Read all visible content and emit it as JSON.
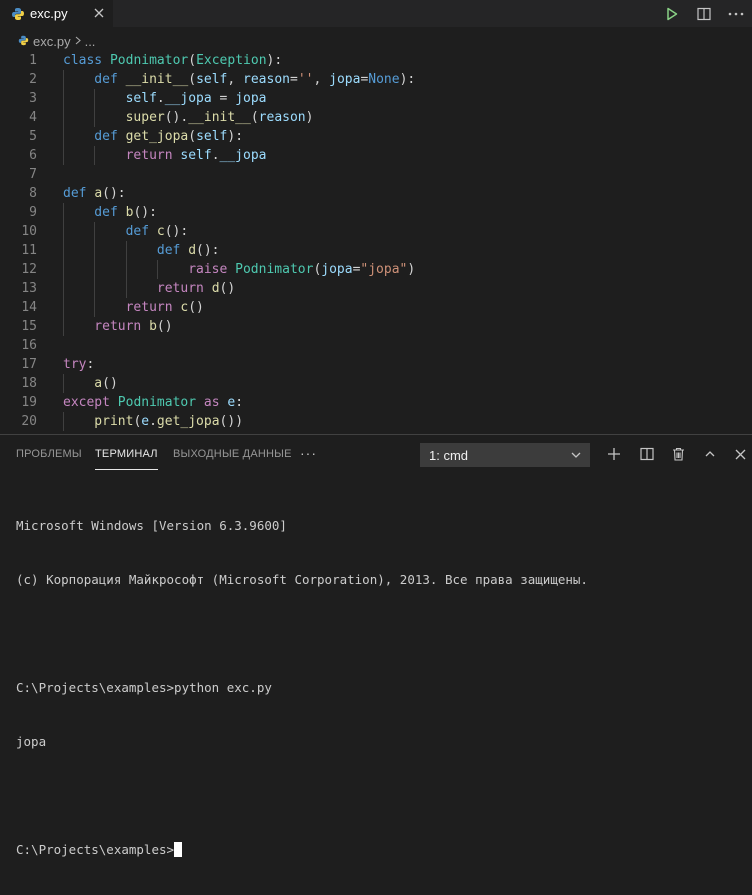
{
  "tab": {
    "filename": "exc.py"
  },
  "breadcrumb": {
    "file": "exc.py",
    "more": "..."
  },
  "editor": {
    "lines": [
      {
        "num": "1",
        "indent": 0,
        "tokens": [
          [
            "kw",
            "class "
          ],
          [
            "cls",
            "Podnimator"
          ],
          [
            "tx",
            "("
          ],
          [
            "cls",
            "Exception"
          ],
          [
            "tx",
            "):"
          ]
        ]
      },
      {
        "num": "2",
        "indent": 1,
        "tokens": [
          [
            "kw",
            "def "
          ],
          [
            "fn",
            "__init__"
          ],
          [
            "tx",
            "("
          ],
          [
            "prm",
            "self"
          ],
          [
            "tx",
            ", "
          ],
          [
            "prm",
            "reason"
          ],
          [
            "tx",
            "="
          ],
          [
            "str",
            "''"
          ],
          [
            "tx",
            ", "
          ],
          [
            "prm",
            "jopa"
          ],
          [
            "tx",
            "="
          ],
          [
            "kw",
            "None"
          ],
          [
            "tx",
            "):"
          ]
        ]
      },
      {
        "num": "3",
        "indent": 2,
        "tokens": [
          [
            "prm",
            "self"
          ],
          [
            "tx",
            "."
          ],
          [
            "prm",
            "__jopa"
          ],
          [
            "tx",
            " = "
          ],
          [
            "prm",
            "jopa"
          ]
        ]
      },
      {
        "num": "4",
        "indent": 2,
        "tokens": [
          [
            "fn",
            "super"
          ],
          [
            "tx",
            "()."
          ],
          [
            "fn",
            "__init__"
          ],
          [
            "tx",
            "("
          ],
          [
            "prm",
            "reason"
          ],
          [
            "tx",
            ")"
          ]
        ]
      },
      {
        "num": "5",
        "indent": 1,
        "tokens": [
          [
            "kw",
            "def "
          ],
          [
            "fn",
            "get_jopa"
          ],
          [
            "tx",
            "("
          ],
          [
            "prm",
            "self"
          ],
          [
            "tx",
            "):"
          ]
        ]
      },
      {
        "num": "6",
        "indent": 2,
        "tokens": [
          [
            "ctl",
            "return "
          ],
          [
            "prm",
            "self"
          ],
          [
            "tx",
            "."
          ],
          [
            "prm",
            "__jopa"
          ]
        ]
      },
      {
        "num": "7",
        "indent": 0,
        "tokens": []
      },
      {
        "num": "8",
        "indent": 0,
        "tokens": [
          [
            "kw",
            "def "
          ],
          [
            "fn",
            "a"
          ],
          [
            "tx",
            "():"
          ]
        ]
      },
      {
        "num": "9",
        "indent": 1,
        "tokens": [
          [
            "kw",
            "def "
          ],
          [
            "fn",
            "b"
          ],
          [
            "tx",
            "():"
          ]
        ]
      },
      {
        "num": "10",
        "indent": 2,
        "tokens": [
          [
            "kw",
            "def "
          ],
          [
            "fn",
            "c"
          ],
          [
            "tx",
            "():"
          ]
        ]
      },
      {
        "num": "11",
        "indent": 3,
        "tokens": [
          [
            "kw",
            "def "
          ],
          [
            "fn",
            "d"
          ],
          [
            "tx",
            "():"
          ]
        ]
      },
      {
        "num": "12",
        "indent": 4,
        "tokens": [
          [
            "ctl",
            "raise "
          ],
          [
            "cls",
            "Podnimator"
          ],
          [
            "tx",
            "("
          ],
          [
            "prm",
            "jopa"
          ],
          [
            "tx",
            "="
          ],
          [
            "str",
            "\"jopa\""
          ],
          [
            "tx",
            ")"
          ]
        ]
      },
      {
        "num": "13",
        "indent": 3,
        "tokens": [
          [
            "ctl",
            "return "
          ],
          [
            "fn",
            "d"
          ],
          [
            "tx",
            "()"
          ]
        ]
      },
      {
        "num": "14",
        "indent": 2,
        "tokens": [
          [
            "ctl",
            "return "
          ],
          [
            "fn",
            "c"
          ],
          [
            "tx",
            "()"
          ]
        ]
      },
      {
        "num": "15",
        "indent": 1,
        "tokens": [
          [
            "ctl",
            "return "
          ],
          [
            "fn",
            "b"
          ],
          [
            "tx",
            "()"
          ]
        ]
      },
      {
        "num": "16",
        "indent": 0,
        "tokens": []
      },
      {
        "num": "17",
        "indent": 0,
        "tokens": [
          [
            "ctl",
            "try"
          ],
          [
            "tx",
            ":"
          ]
        ]
      },
      {
        "num": "18",
        "indent": 1,
        "tokens": [
          [
            "fn",
            "a"
          ],
          [
            "tx",
            "()"
          ]
        ]
      },
      {
        "num": "19",
        "indent": 0,
        "tokens": [
          [
            "ctl",
            "except "
          ],
          [
            "cls",
            "Podnimator"
          ],
          [
            "ctl",
            " as "
          ],
          [
            "prm",
            "e"
          ],
          [
            "tx",
            ":"
          ]
        ]
      },
      {
        "num": "20",
        "indent": 1,
        "tokens": [
          [
            "fn",
            "print"
          ],
          [
            "tx",
            "("
          ],
          [
            "prm",
            "e"
          ],
          [
            "tx",
            "."
          ],
          [
            "fn",
            "get_jopa"
          ],
          [
            "tx",
            "())"
          ]
        ]
      }
    ]
  },
  "panel": {
    "tabs": [
      "ПРОБЛЕМЫ",
      "ТЕРМИНАЛ",
      "ВЫХОДНЫЕ ДАННЫЕ"
    ],
    "active_tab": "ТЕРМИНАЛ",
    "more": "···",
    "terminal_select": "1: cmd"
  },
  "terminal": {
    "line1": "Microsoft Windows [Version 6.3.9600]",
    "line2": "(c) Корпорация Майкрософт (Microsoft Corporation), 2013. Все права защищены.",
    "line3": "",
    "line4": "C:\\Projects\\examples>python exc.py",
    "line5": "jopa",
    "line6": "",
    "prompt": "C:\\Projects\\examples>"
  },
  "colors": {
    "background": "#1e1e1e",
    "keyword": "#569cd6",
    "function": "#dcdcaa",
    "class": "#4ec9b0",
    "parameter": "#9cdcfe",
    "string": "#ce9178",
    "control": "#c586c0",
    "run_icon": "#89d185"
  }
}
